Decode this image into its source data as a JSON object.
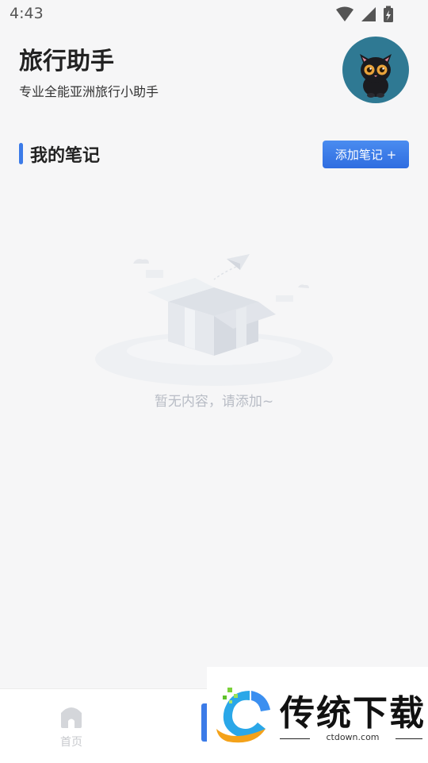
{
  "status_bar": {
    "time": "4:43"
  },
  "header": {
    "title": "旅行助手",
    "subtitle": "专业全能亚洲旅行小助手"
  },
  "notes_section": {
    "title": "我的笔记",
    "add_button_label": "添加笔记 +"
  },
  "empty_state": {
    "message": "暂无内容，请添加~"
  },
  "tab_bar": {
    "home_label": "首页"
  },
  "watermark": {
    "title": "传统下载",
    "url": "ctdown.com"
  },
  "colors": {
    "accent": "#3b7be8",
    "background": "#f6f6f7"
  }
}
